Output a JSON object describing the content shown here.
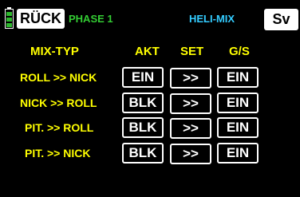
{
  "header": {
    "back_label": "RÜCK",
    "phase": "PHASE 1",
    "title": "HELI-MIX",
    "sv_label": "Sv"
  },
  "columns": {
    "mix_typ": "MIX-TYP",
    "akt": "AKT",
    "set": "SET",
    "gs": "G/S"
  },
  "rows": [
    {
      "label": "ROLL >> NICK",
      "akt": "EIN",
      "set": ">>",
      "gs": "EIN"
    },
    {
      "label": "NICK >> ROLL",
      "akt": "BLK",
      "set": ">>",
      "gs": "EIN"
    },
    {
      "label": "PIT. >> ROLL",
      "akt": "BLK",
      "set": ">>",
      "gs": "EIN"
    },
    {
      "label": "PIT. >> NICK",
      "akt": "BLK",
      "set": ">>",
      "gs": "EIN"
    }
  ],
  "colors": {
    "background": "#000000",
    "labels": "#ffff00",
    "phase": "#33cc33",
    "title": "#33ccff",
    "battery": "#2eb82e"
  }
}
